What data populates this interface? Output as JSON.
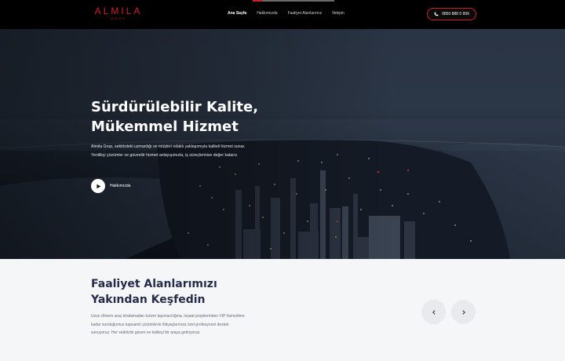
{
  "brand": {
    "name": "ALMILA",
    "sub": "GRUP",
    "accent": "#c8202a"
  },
  "nav": {
    "items": [
      {
        "label": "Ana Sayfa",
        "active": true
      },
      {
        "label": "Hakkımızda",
        "active": false
      },
      {
        "label": "Faaliyet Alanlarımız",
        "active": false
      },
      {
        "label": "İletişim",
        "active": false
      }
    ]
  },
  "contact": {
    "phone": "0850 888 0 999",
    "icon": "phone-icon"
  },
  "hero": {
    "title_line1": "Sürdürülebilir Kalite,",
    "title_line2": "Mükemmel Hizmet",
    "text": "Almila Grup, sektördeki uzmanlığı ve müşteri odaklı yaklaşımıyla kaliteli hizmet sunar. Yenilikçi çözümler ve güvenilir hizmet anlayışımızla, iş süreçlerinize değer katarız.",
    "play_label": "Hakkımızda"
  },
  "activities": {
    "title_line1": "Faaliyet Alanlarımızı",
    "title_line2": "Yakından Keşfedin",
    "text": "Uzun dönem araç kiralamadan turizm taşımacılığına, inşaat projelerinden VIP hizmetlere kadar sunduğumuz kapsamlı çözümlerle ihtiyaçlarınıza özel profesyonel destek sunuyoruz. Her sektörde güven ve kaliteyi bir araya getiriyoruz.",
    "prev_icon": "chevron-left-icon",
    "next_icon": "chevron-right-icon"
  },
  "colors": {
    "header_bg": "#000000",
    "section_bg": "#f5f6f8",
    "heading": "#262b4a"
  }
}
